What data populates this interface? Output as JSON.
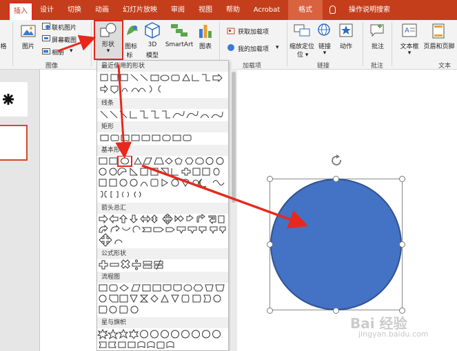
{
  "tabs": [
    "插入",
    "设计",
    "切换",
    "动画",
    "幻灯片放映",
    "审阅",
    "视图",
    "帮助",
    "Acrobat",
    "格式"
  ],
  "tell_me": "操作说明搜索",
  "ribbon": {
    "left_cut_label": "格",
    "picture": "图片",
    "online_pictures": "联机图片",
    "screenshot": "屏幕截图",
    "album": "相册",
    "images_group": "图像",
    "shapes": "形状",
    "icons": "图标",
    "model3d_line1": "3D",
    "model3d_line2": "模型",
    "smartart": "SmartArt",
    "chart": "图表",
    "get_addins": "获取加载项",
    "my_addins": "我的加载项",
    "addins_group": "加载项",
    "zoom": "缩放定位",
    "link": "链接",
    "action": "动作",
    "links_group": "链接",
    "comment": "批注",
    "comments_group": "批注",
    "textbox": "文本框",
    "header_footer": "页眉和页脚",
    "text_group": "文本"
  },
  "dropdown": {
    "categories": [
      "最近使用的形状",
      "线条",
      "矩形",
      "基本形状",
      "箭头总汇",
      "公式形状",
      "流程图",
      "星与旗帜"
    ]
  },
  "watermark": {
    "brand": "Bai 经验",
    "url": "jingyan.baidu.com"
  },
  "colors": {
    "accent": "#c43e1c",
    "highlight": "#e0281c",
    "shape_fill": "#4472c4",
    "shape_border": "#2f528f",
    "arrow": "#e8281c"
  }
}
